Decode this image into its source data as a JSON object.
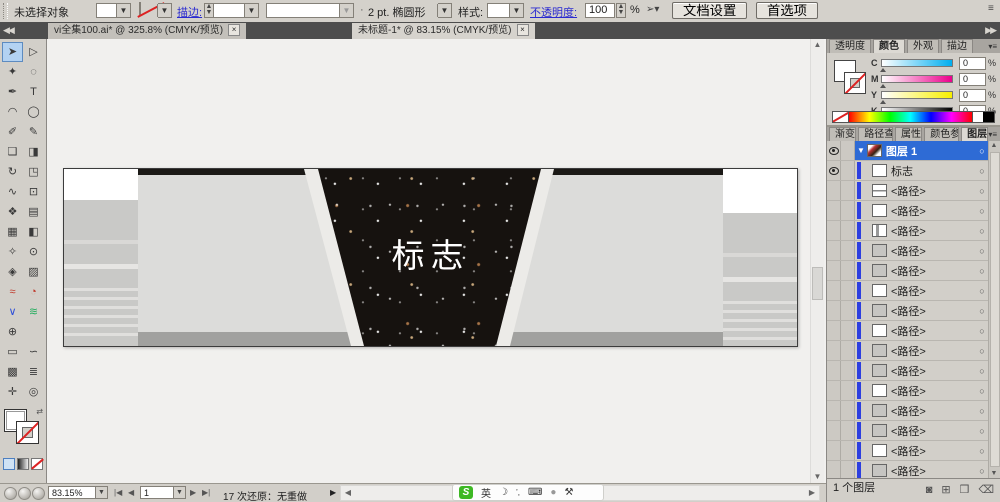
{
  "controlbar": {
    "selection_status": "未选择对象",
    "stroke_label": "描边:",
    "brush_label": "2 pt. 椭圆形",
    "style_label": "样式:",
    "opacity_label": "不透明度:",
    "opacity_value": "100",
    "opacity_unit": "%",
    "doc_setup_button": "文档设置",
    "preferences_button": "首选项"
  },
  "tabs": [
    {
      "title": "vi全集100.ai* @ 325.8% (CMYK/预览)"
    },
    {
      "title": "未标题-1* @ 83.15% (CMYK/预览)"
    }
  ],
  "tools": {
    "items": [
      {
        "name": "selection",
        "glyph": "➤",
        "active": true
      },
      {
        "name": "direct-selection",
        "glyph": "▷"
      },
      {
        "name": "magic-wand",
        "glyph": "✦"
      },
      {
        "name": "lasso",
        "glyph": "◌"
      },
      {
        "name": "pen",
        "glyph": "✒"
      },
      {
        "name": "type",
        "glyph": "T"
      },
      {
        "name": "arc",
        "glyph": "◠"
      },
      {
        "name": "ellipse",
        "glyph": "◯"
      },
      {
        "name": "paintbrush",
        "glyph": "✐"
      },
      {
        "name": "pencil",
        "glyph": "✎"
      },
      {
        "name": "blob-brush",
        "glyph": "❑"
      },
      {
        "name": "eraser",
        "glyph": "◨"
      },
      {
        "name": "rotate",
        "glyph": "↻"
      },
      {
        "name": "scale",
        "glyph": "◳"
      },
      {
        "name": "warp",
        "glyph": "∿"
      },
      {
        "name": "free-transform",
        "glyph": "⊡"
      },
      {
        "name": "symbol-sprayer",
        "glyph": "❖"
      },
      {
        "name": "column-graph",
        "glyph": "▤"
      },
      {
        "name": "mesh",
        "glyph": "▦"
      },
      {
        "name": "gradient",
        "glyph": "◧"
      },
      {
        "name": "eyedropper",
        "glyph": "✧"
      },
      {
        "name": "blend",
        "glyph": "⊙"
      },
      {
        "name": "live-paint",
        "glyph": "◈"
      },
      {
        "name": "live-paint-selection",
        "glyph": "▨"
      },
      {
        "name": "scatter-graph",
        "glyph": "≈",
        "color": "#c0392b"
      },
      {
        "name": "pie-graph",
        "glyph": "◔",
        "color": "#c0392b"
      },
      {
        "name": "radar-graph",
        "glyph": "∨",
        "color": "#2e4fd8"
      },
      {
        "name": "area-graph",
        "glyph": "≋",
        "color": "#27ae60"
      },
      {
        "name": "crosshair-target",
        "glyph": "⊕"
      },
      {
        "name": "spacer",
        "glyph": ""
      },
      {
        "name": "envelope",
        "glyph": "▭"
      },
      {
        "name": "reshape",
        "glyph": "∽"
      },
      {
        "name": "slice",
        "glyph": "▩"
      },
      {
        "name": "paragraph",
        "glyph": "≣"
      },
      {
        "name": "hand",
        "glyph": "✛"
      },
      {
        "name": "zoom",
        "glyph": "◎"
      }
    ]
  },
  "artboard": {
    "label": "标志"
  },
  "dock": {
    "group1_tabs": [
      {
        "label": "透明度",
        "active": false
      },
      {
        "label": "颜色",
        "active": true
      },
      {
        "label": "外观",
        "active": false
      },
      {
        "label": "描边",
        "active": false
      }
    ],
    "color_panel": {
      "channels": [
        {
          "label": "C",
          "value": "0",
          "unit": "%"
        },
        {
          "label": "M",
          "value": "0",
          "unit": "%"
        },
        {
          "label": "Y",
          "value": "0",
          "unit": "%"
        },
        {
          "label": "K",
          "value": "0",
          "unit": "%"
        }
      ]
    },
    "group2_tabs": [
      {
        "label": "渐变",
        "active": false
      },
      {
        "label": "路径查",
        "active": false
      },
      {
        "label": "属性",
        "active": false
      },
      {
        "label": "颜色参",
        "active": false
      },
      {
        "label": "图层",
        "active": true
      }
    ],
    "layers": {
      "rows": [
        {
          "label": "图层 1",
          "selected": true,
          "expand": true,
          "eye": true,
          "thumb": "art"
        },
        {
          "label": "标志",
          "eye": true,
          "thumb": "white",
          "indent": true
        },
        {
          "label": "<路径>",
          "thumb": "hline",
          "indent": true
        },
        {
          "label": "<路径>",
          "thumb": "white",
          "indent": true
        },
        {
          "label": "<路径>",
          "thumb": "vbar",
          "indent": true
        },
        {
          "label": "<路径>",
          "thumb": "gray",
          "indent": true
        },
        {
          "label": "<路径>",
          "thumb": "gray",
          "indent": true
        },
        {
          "label": "<路径>",
          "thumb": "white",
          "indent": true
        },
        {
          "label": "<路径>",
          "thumb": "gray",
          "indent": true
        },
        {
          "label": "<路径>",
          "thumb": "white",
          "indent": true
        },
        {
          "label": "<路径>",
          "thumb": "gray",
          "indent": true
        },
        {
          "label": "<路径>",
          "thumb": "gray",
          "indent": true
        },
        {
          "label": "<路径>",
          "thumb": "white",
          "indent": true
        },
        {
          "label": "<路径>",
          "thumb": "gray",
          "indent": true
        },
        {
          "label": "<路径>",
          "thumb": "gray",
          "indent": true
        },
        {
          "label": "<路径>",
          "thumb": "white",
          "indent": true
        },
        {
          "label": "<路径>",
          "thumb": "gray",
          "indent": true
        }
      ],
      "footer": "1 个图层"
    }
  },
  "statusbar": {
    "zoom": "83.15%",
    "page": "1",
    "undo_status": "17 次还原：无重做"
  },
  "ime": {
    "mode": "英"
  },
  "colors": {
    "selection_blue": "#2e6bd5",
    "layer_bar_blue": "#2d3fe0",
    "link_blue": "#2b2bd0",
    "chrome": "#d2cfc9",
    "tabbar_dark": "#4d4d4d",
    "cyan": "#00aeef",
    "magenta": "#ec008c",
    "yellow": "#f7ef00"
  }
}
